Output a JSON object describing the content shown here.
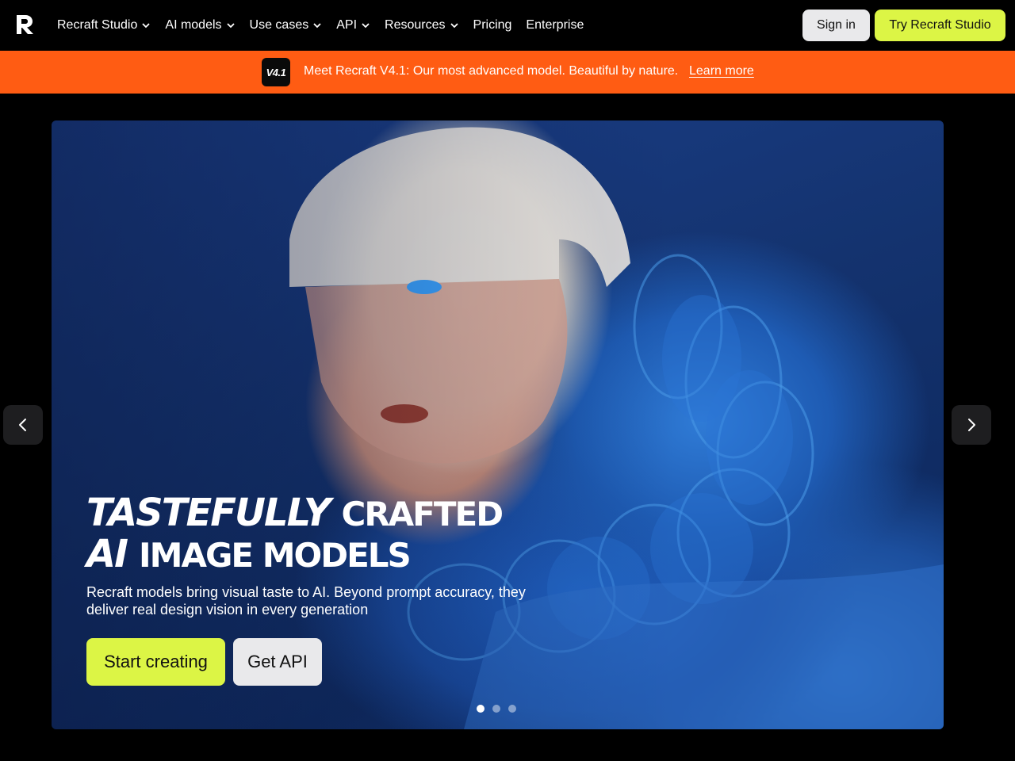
{
  "nav": {
    "logo": "recraft-logo-icon",
    "items": [
      {
        "label": "Recraft Studio",
        "dropdown": true
      },
      {
        "label": "AI models",
        "dropdown": true
      },
      {
        "label": "Use cases",
        "dropdown": true
      },
      {
        "label": "API",
        "dropdown": true
      },
      {
        "label": "Resources",
        "dropdown": true
      },
      {
        "label": "Pricing",
        "dropdown": false
      },
      {
        "label": "Enterprise",
        "dropdown": false
      }
    ],
    "sign_in": "Sign in",
    "try_studio": "Try Recraft Studio"
  },
  "announcement": {
    "badge": "V4.1",
    "text": "Meet Recraft V4.1: Our most advanced model. Beautiful by nature.",
    "link": "Learn more"
  },
  "hero": {
    "title_line1_italic": "TASTEFULLY",
    "title_line1_rest": "CRAFTED",
    "title_line2_italic": "AI",
    "title_line2_rest": "IMAGE MODELS",
    "subtitle": "Recraft models bring visual taste to AI. Beyond prompt accuracy, they deliver real design vision in every generation",
    "primary_cta": "Start creating",
    "secondary_cta": "Get API",
    "slides": 3,
    "active_slide": 1
  },
  "carousel": {
    "prev_icon": "chevron-left-icon",
    "next_icon": "chevron-right-icon"
  },
  "colors": {
    "background": "#000000",
    "accent_lime": "#dcf545",
    "announcement_orange": "#ff5c13",
    "button_light": "#e9e9eb",
    "hero_blue": "#1b3f8a"
  }
}
